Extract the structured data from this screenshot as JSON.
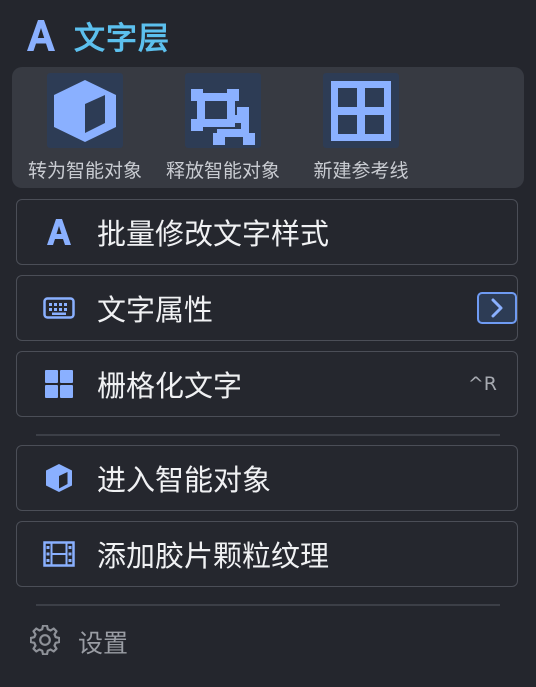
{
  "header": {
    "title": "文字层",
    "icon": "text-a-icon"
  },
  "toolbar": {
    "items": [
      {
        "label": "转为智能对象",
        "icon": "cube-icon"
      },
      {
        "label": "释放智能对象",
        "icon": "release-frame-icon"
      },
      {
        "label": "新建参考线",
        "icon": "guides-grid-icon"
      }
    ]
  },
  "menu": {
    "items": [
      {
        "label": "批量修改文字样式",
        "icon": "text-a-icon"
      },
      {
        "label": "文字属性",
        "icon": "keyboard-icon",
        "submenu_icon": "chevron-right-icon"
      },
      {
        "label": "栅格化文字",
        "icon": "grid-squares-icon",
        "shortcut": "^R"
      },
      {
        "label": "进入智能对象",
        "icon": "cube-icon"
      },
      {
        "label": "添加胶片颗粒纹理",
        "icon": "film-icon"
      }
    ]
  },
  "settings": {
    "label": "设置",
    "icon": "gear-icon"
  },
  "colors": {
    "background": "#24262d",
    "accent": "#6f9bf3",
    "title": "#5cc0ee",
    "icon_fill": "#8ab0ff"
  }
}
